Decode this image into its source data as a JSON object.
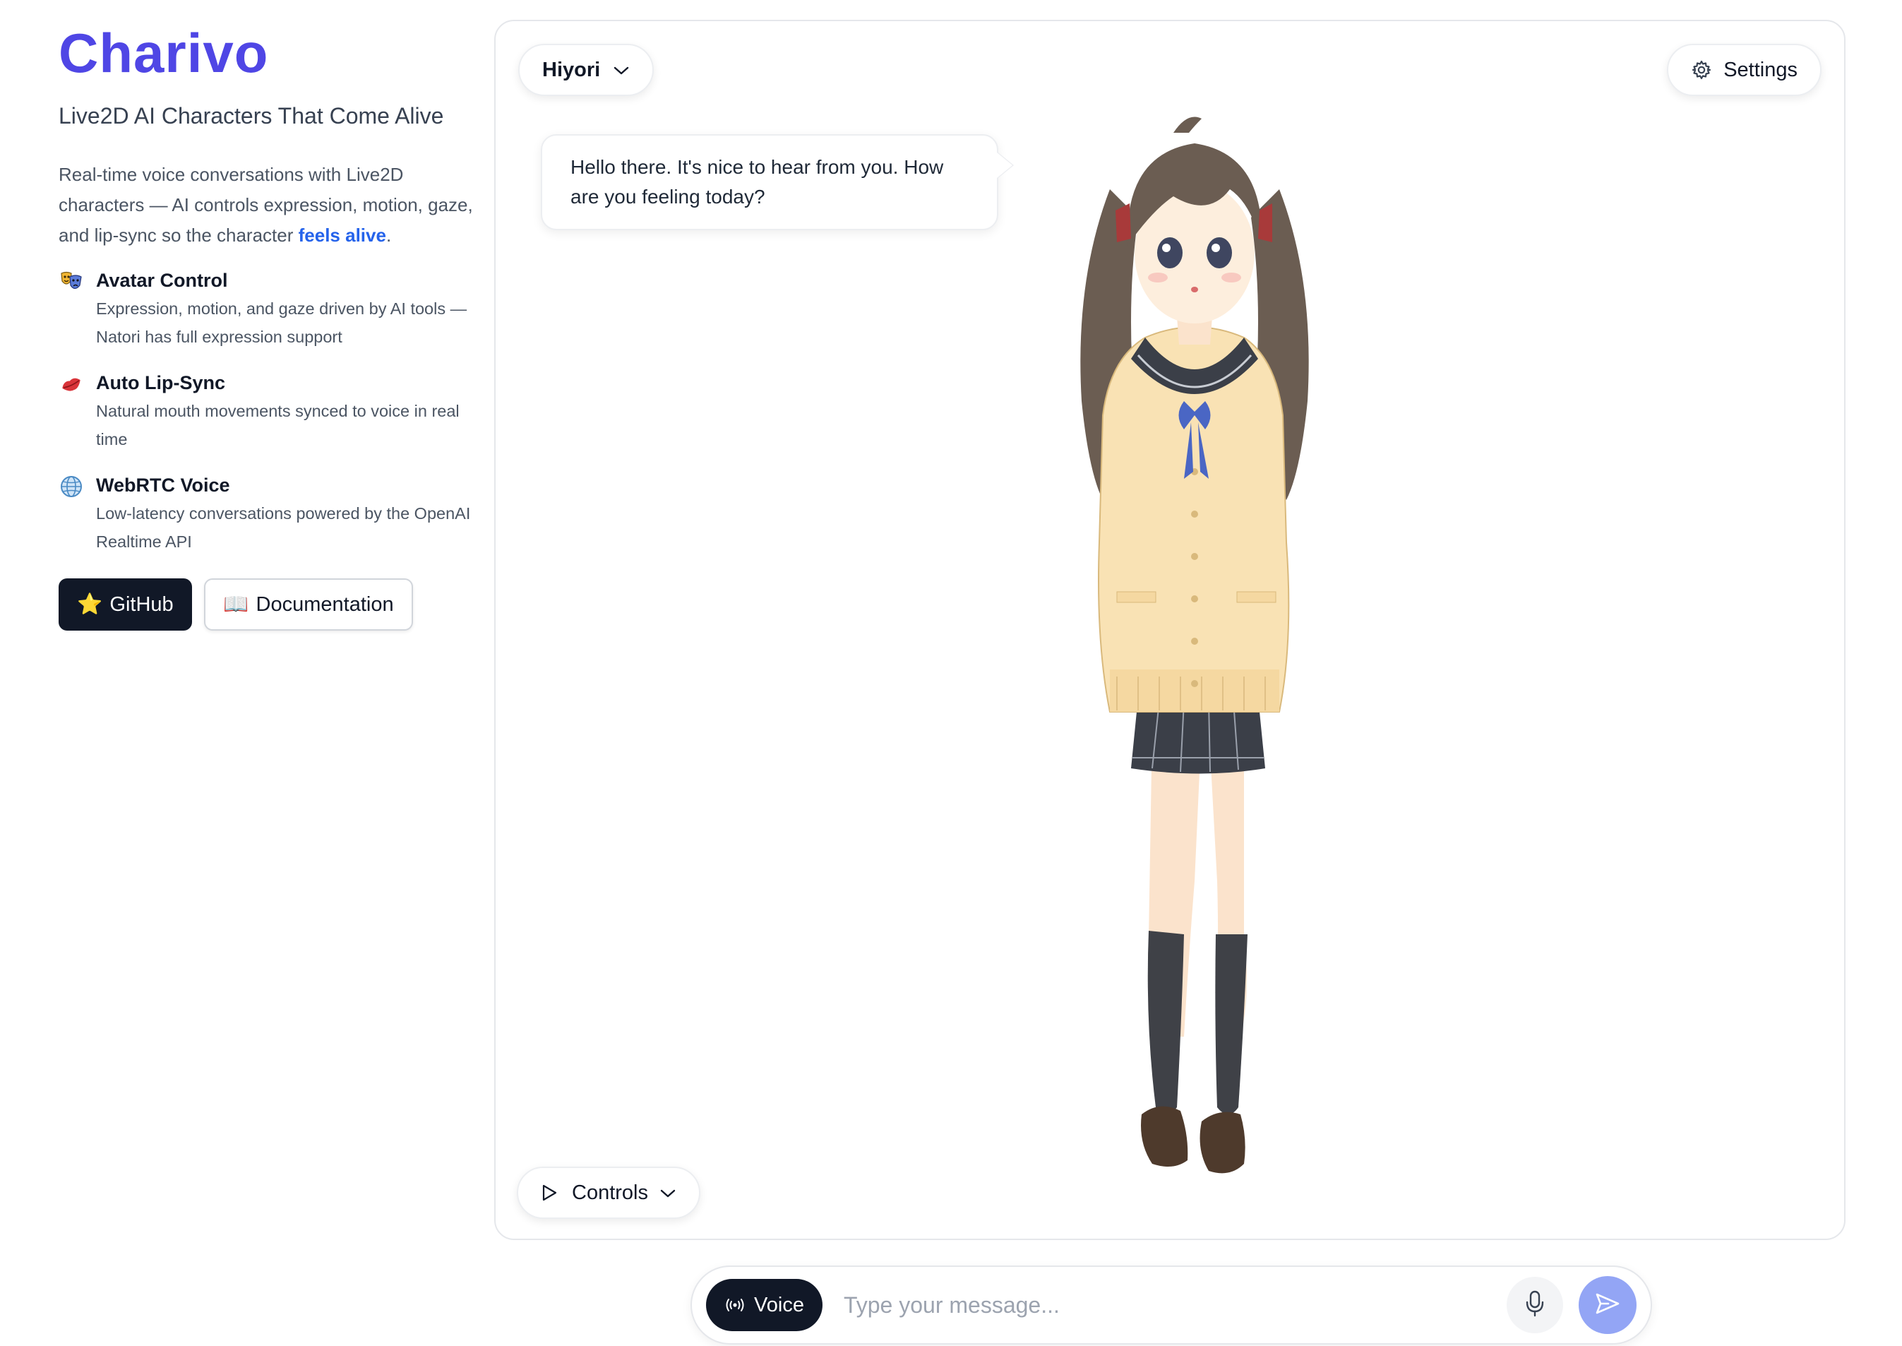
{
  "sidebar": {
    "brand": "Charivo",
    "tagline": "Live2D AI Characters That Come Alive",
    "intro_prefix": "Real-time voice conversations with Live2D characters — AI controls expression, motion, gaze, and lip-sync so the character ",
    "intro_highlight": "feels alive",
    "intro_suffix": ".",
    "features": [
      {
        "icon": "theater-masks-icon",
        "title": "Avatar Control",
        "desc": "Expression, motion, and gaze driven by AI tools — Natori has full expression support"
      },
      {
        "icon": "lips-icon",
        "title": "Auto Lip-Sync",
        "desc": "Natural mouth movements synced to voice in real time"
      },
      {
        "icon": "globe-icon",
        "title": "WebRTC Voice",
        "desc": "Low-latency conversations powered by the OpenAI Realtime API"
      }
    ],
    "buttons": {
      "github_icon": "⭐",
      "github": "GitHub",
      "docs_icon": "📖",
      "docs": "Documentation"
    }
  },
  "stage": {
    "character_name": "Hiyori",
    "settings_label": "Settings",
    "controls_label": "Controls",
    "speech_bubble": "Hello there. It's nice to hear from you. How are you feeling today?"
  },
  "chatbar": {
    "voice_label": "Voice",
    "placeholder": "Type your message...",
    "value": ""
  },
  "colors": {
    "brand": "#4f46e5",
    "highlight": "#2563eb",
    "dark_button": "#111827",
    "send_button": "#93a5f5"
  }
}
